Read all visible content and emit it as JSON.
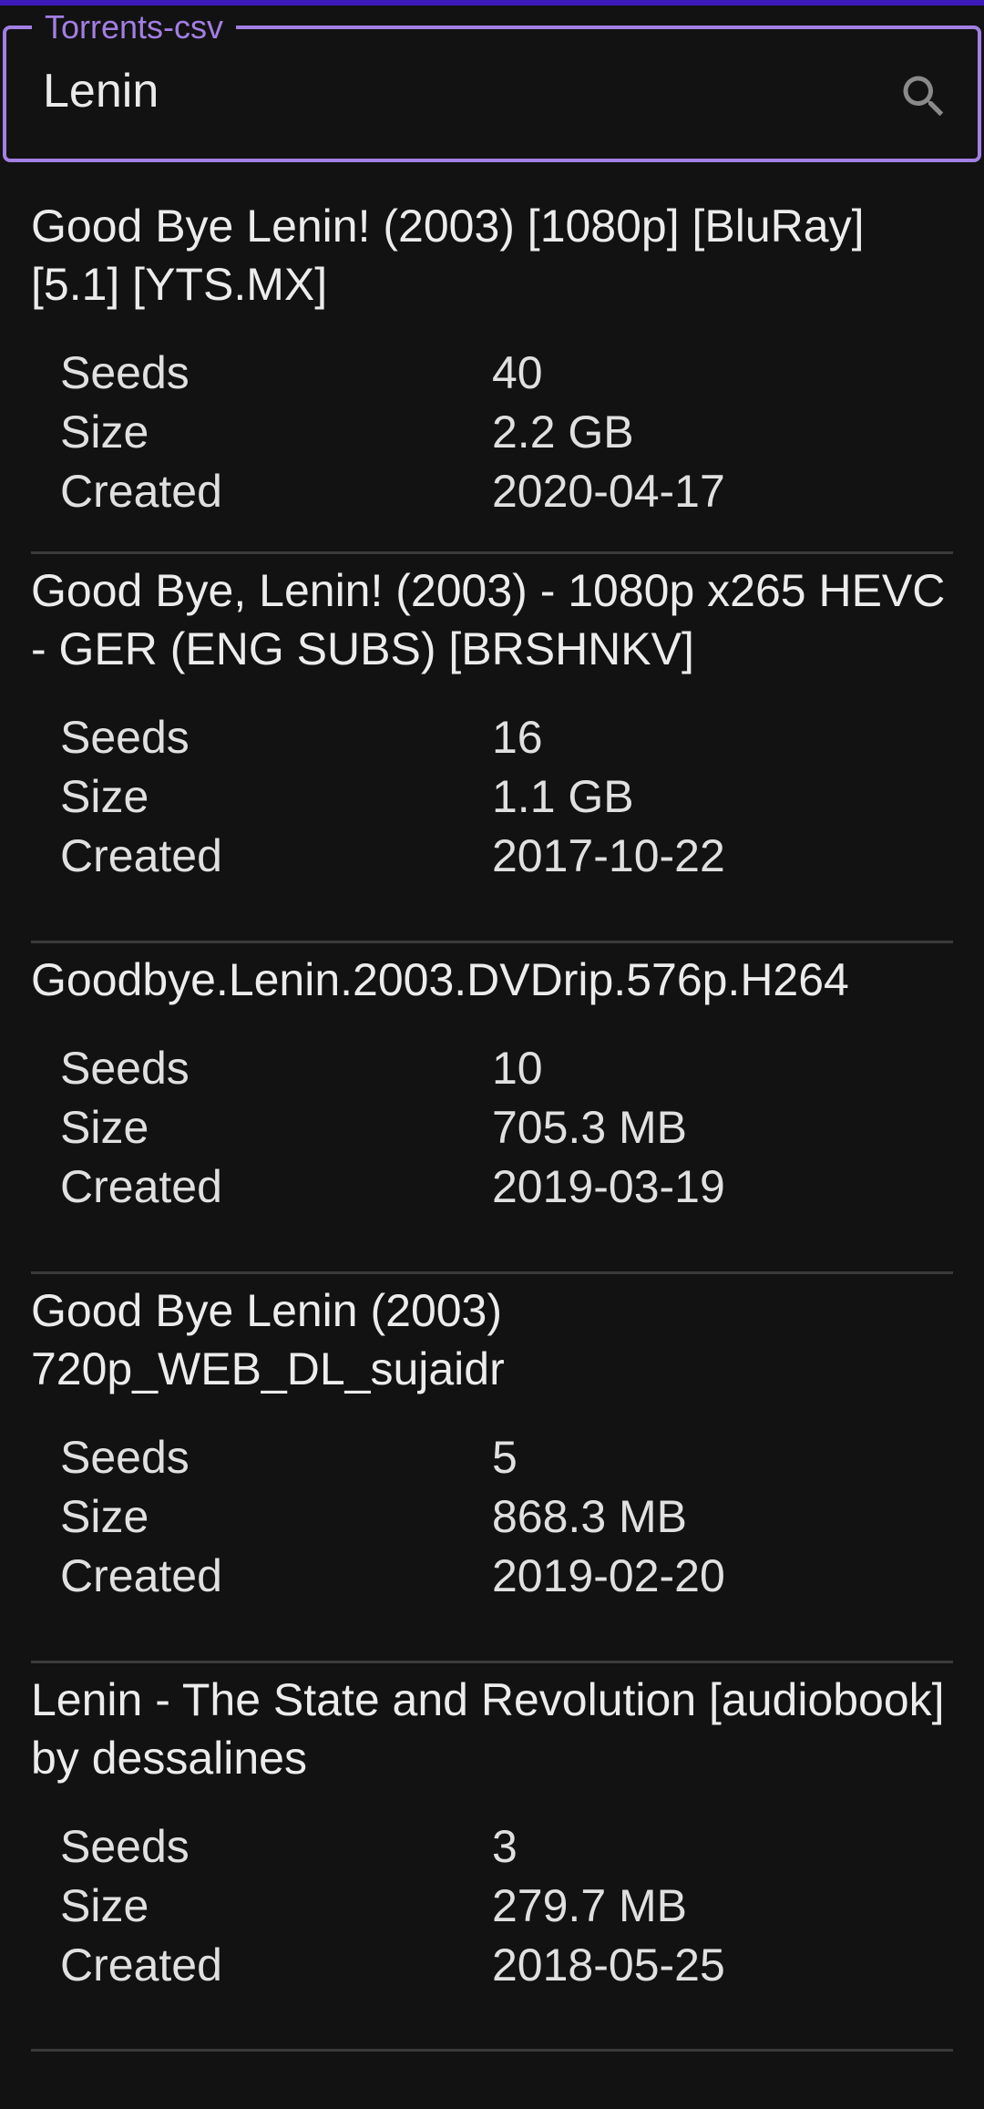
{
  "app": {
    "search_label": "Torrents-csv",
    "search_value": "Lenin",
    "search_icon": "search-icon"
  },
  "stat_labels": {
    "seeds": "Seeds",
    "size": "Size",
    "created": "Created"
  },
  "results": [
    {
      "title": "Good Bye Lenin! (2003) [1080p] [BluRay] [5.1] [YTS.MX]",
      "seeds": "40",
      "size": "2.2 GB",
      "created": "2020-04-17"
    },
    {
      "title": "Good Bye, Lenin! (2003) - 1080p x265 HEVC - GER (ENG SUBS) [BRSHNKV]",
      "seeds": "16",
      "size": "1.1 GB",
      "created": "2017-10-22"
    },
    {
      "title": "Goodbye.Lenin.2003.DVDrip.576p.H264",
      "seeds": "10",
      "size": "705.3 MB",
      "created": "2019-03-19"
    },
    {
      "title": "Good Bye Lenin (2003) 720p_WEB_DL_sujaidr",
      "seeds": "5",
      "size": "868.3 MB",
      "created": "2019-02-20"
    },
    {
      "title": "Lenin - The State and Revolution [audiobook] by dessalines",
      "seeds": "3",
      "size": "279.7 MB",
      "created": "2018-05-25"
    }
  ]
}
